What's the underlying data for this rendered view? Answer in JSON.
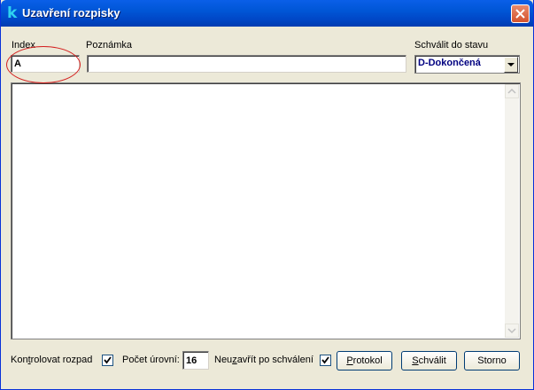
{
  "window": {
    "title": "Uzavření rozpisky",
    "icon": "k-app-icon"
  },
  "fields": {
    "index_label": "Index",
    "index_value": "A",
    "note_label": "Poznámka",
    "note_value": "",
    "approve_label": "Schválit do stavu",
    "approve_value": "D-Dokončená"
  },
  "footer": {
    "check_split_label_pre": "Kon",
    "check_split_label_u": "t",
    "check_split_label_post": "rolovat rozpad",
    "check_split_checked": true,
    "levels_label": "Počet úrovní:",
    "levels_value": "16",
    "no_close_label_pre": "Neu",
    "no_close_label_u": "z",
    "no_close_label_post": "avřít po schválení",
    "no_close_checked": true,
    "protocol_button_u": "P",
    "protocol_button_rest": "rotokol",
    "approve_button_u": "S",
    "approve_button_rest": "chválit",
    "cancel_button": "Storno"
  },
  "colors": {
    "titlebar": "#0054e3",
    "annotation": "#d42020"
  }
}
